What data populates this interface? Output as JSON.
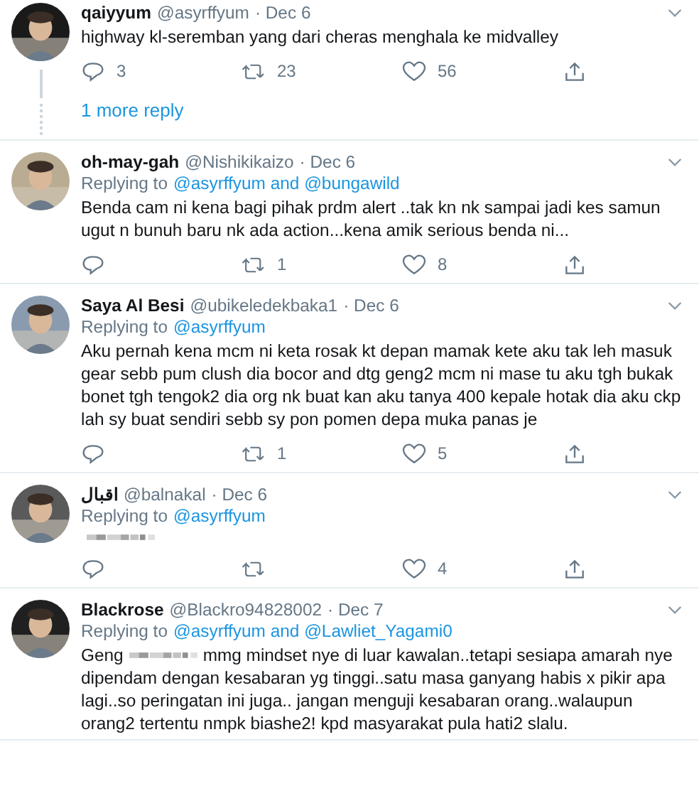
{
  "tweets": [
    {
      "name": "qaiyyum",
      "handle": "@asyrffyum",
      "date": "· Dec 6",
      "body": [
        {
          "kind": "block",
          "text": "highway kl-seremban yang dari cheras menghala ke midvalley"
        }
      ],
      "replies": "3",
      "retweets": "23",
      "likes": "56",
      "more_replies": "1 more reply"
    },
    {
      "name": "oh-may-gah",
      "handle": "@Nishikikaizo",
      "date": "· Dec 6",
      "replying_label": "Replying to",
      "replying_to": "@asyrffyum and @bungawild",
      "body": [
        {
          "kind": "block",
          "text": "Benda cam ni kena bagi pihak prdm alert ..tak kn nk sampai jadi kes samun ugut n bunuh baru nk ada action...kena amik serious benda ni..."
        }
      ],
      "retweets": "1",
      "likes": "8"
    },
    {
      "name": "Saya Al Besi",
      "handle": "@ubikeledekbaka1",
      "date": "· Dec 6",
      "replying_label": "Replying to",
      "replying_to": "@asyrffyum",
      "body": [
        {
          "kind": "block",
          "text": "Aku pernah kena mcm ni keta rosak kt depan mamak kete aku tak leh masuk gear sebb pum clush dia bocor and dtg geng2 mcm ni mase tu aku tgh bukak bonet tgh tengok2 dia org nk buat kan aku tanya 400 kepale hotak dia aku ckp lah sy buat sendiri sebb sy pon pomen depa muka panas je"
        }
      ],
      "retweets": "1",
      "likes": "5"
    },
    {
      "name": "اقبال",
      "handle": "@balnakal",
      "date": "· Dec 6",
      "replying_label": "Replying to",
      "replying_to": "@asyrffyum",
      "body": [
        {
          "kind": "redacted"
        }
      ],
      "likes": "4"
    },
    {
      "name": "Blackrose",
      "handle": "@Blackro94828002",
      "date": "· Dec 7",
      "replying_label": "Replying to",
      "replying_to": "@asyrffyum and @Lawliet_Yagami0",
      "body": [
        {
          "kind": "inline",
          "text": "Geng"
        },
        {
          "kind": "redacted"
        },
        {
          "kind": "inline",
          "text": "mmg mindset nye di luar kawalan..tetapi sesiapa amarah nye"
        },
        {
          "kind": "block",
          "text": "dipendam dengan kesabaran yg tinggi..satu masa ganyang habis x pikir apa lagi..so peringatan ini juga.. jangan menguji kesabaran orang..walaupun orang2 tertentu nmpk biashe2! kpd masyarakat pula hati2 slalu."
        }
      ]
    }
  ]
}
